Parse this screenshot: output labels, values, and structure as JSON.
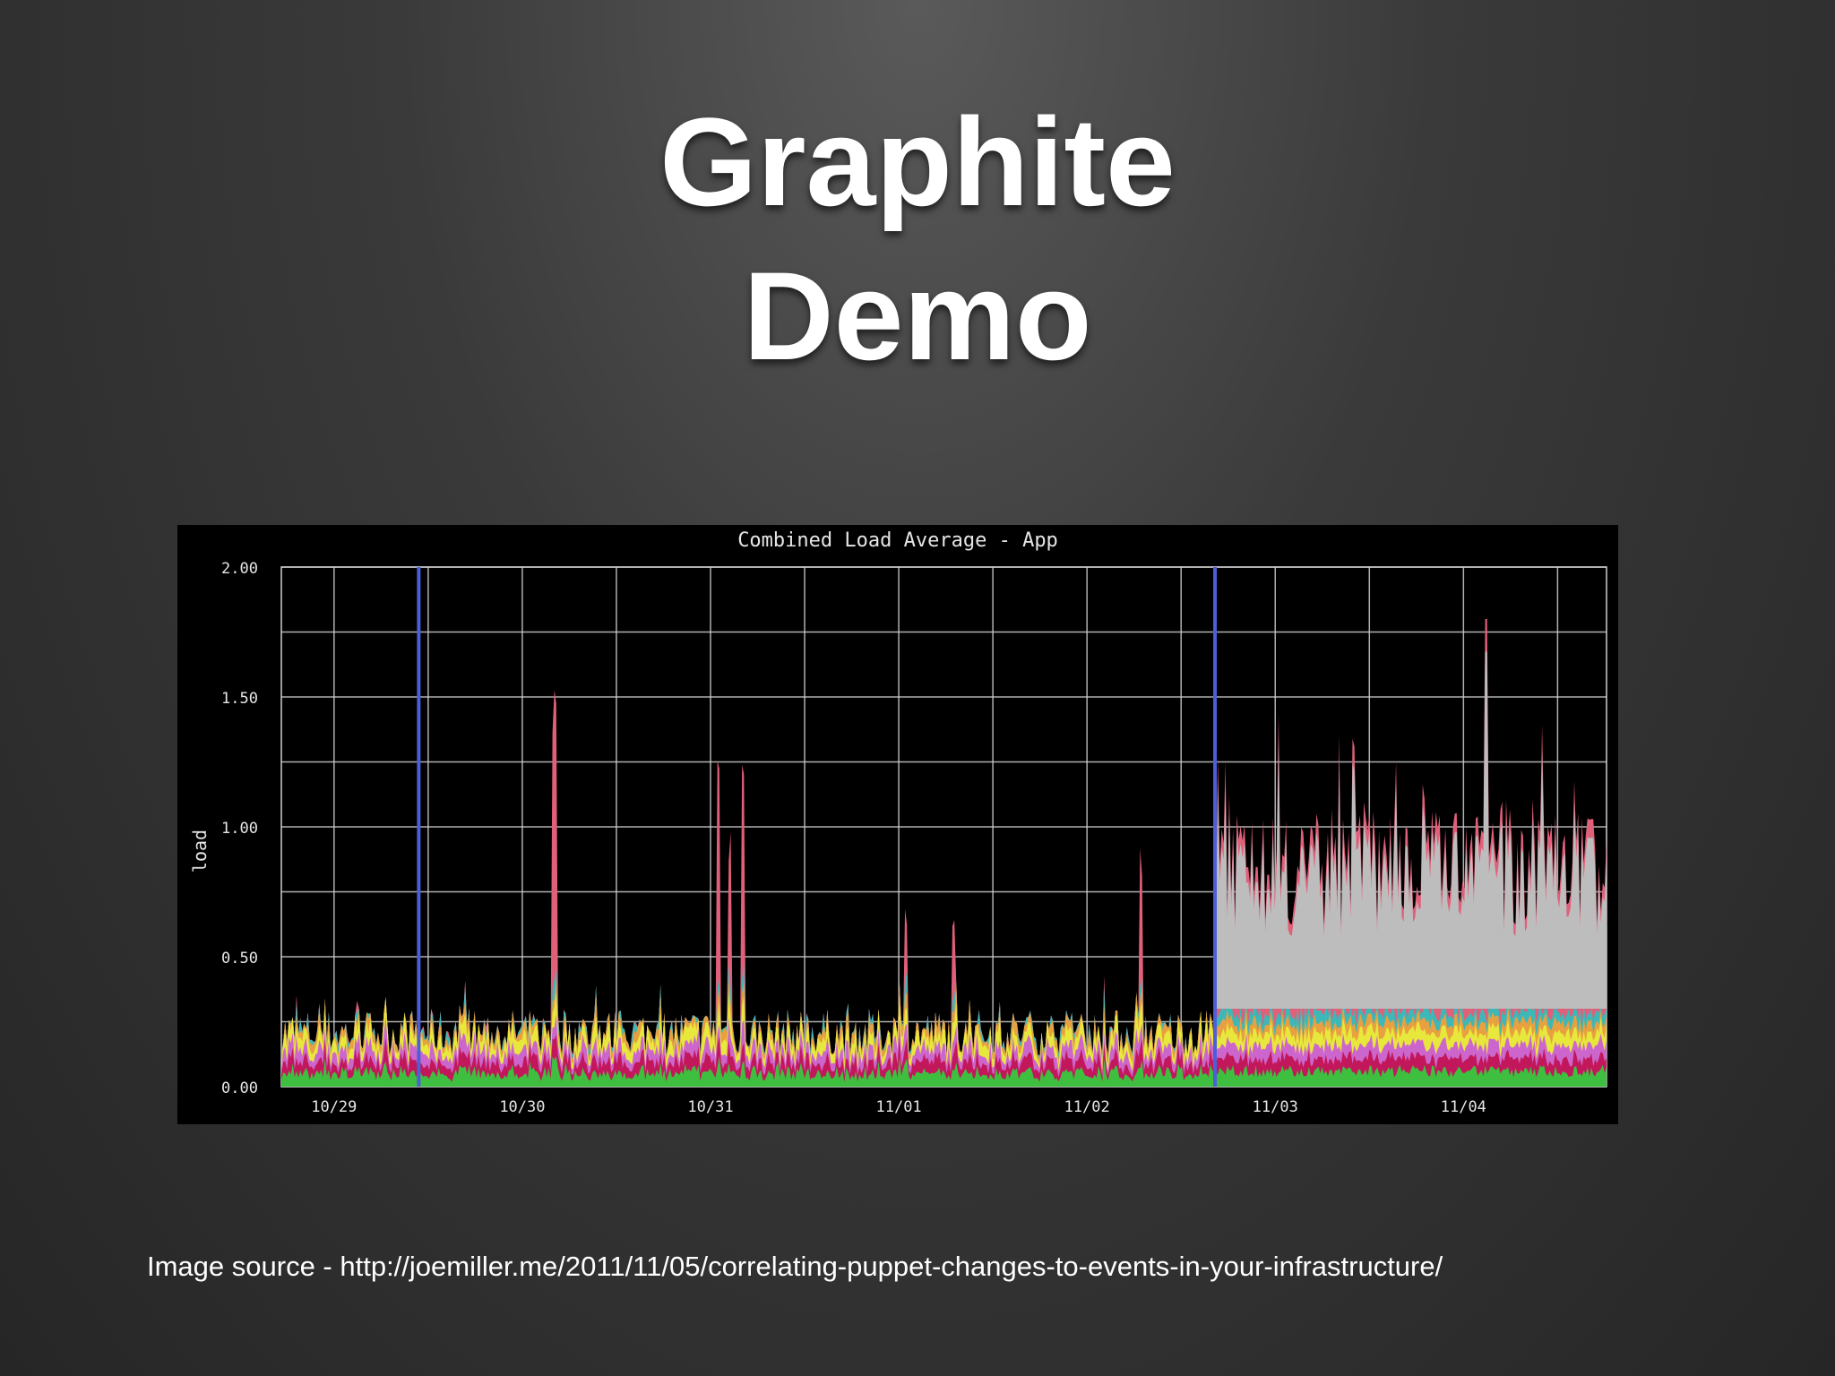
{
  "slide": {
    "title_line1": "Graphite",
    "title_line2": "Demo",
    "caption": "Image source - http://joemiller.me/2011/11/05/correlating-puppet-changes-to-events-in-your-infrastructure/"
  },
  "chart_data": {
    "type": "area",
    "title": "Combined Load Average - App",
    "ylabel": "load",
    "xlabel": "",
    "ylim": [
      0,
      2.0
    ],
    "yticks": [
      "0.00",
      "0.50",
      "1.00",
      "1.50",
      "2.00"
    ],
    "xticks": [
      "10/29",
      "10/30",
      "10/31",
      "11/01",
      "11/02",
      "11/03",
      "11/04"
    ],
    "grid": true,
    "stacked": true,
    "background": "#000000",
    "grid_color": "#cfcfcf",
    "event_marker_color": "#4a5fd8",
    "event_markers": [
      "10/29 ~11:00",
      "11/02 ~16:00"
    ],
    "series_colors": [
      "#3fbf3f",
      "#c2185b",
      "#cc66cc",
      "#e8e83c",
      "#e8a040",
      "#3cb8b8",
      "#e0607a",
      "#bdbdbd"
    ],
    "summary": {
      "baseline_10/28_to_11/02": [
        0.05,
        0.35
      ],
      "spikes": [
        {
          "x": "10/30 ~04:00",
          "y": 1.55
        },
        {
          "x": "10/31 ~01:00",
          "y": 1.3
        },
        {
          "x": "10/31 ~04:00",
          "y": 1.35
        },
        {
          "x": "11/01 ~01:00",
          "y": 0.72
        },
        {
          "x": "11/01 ~07:00",
          "y": 0.65
        },
        {
          "x": "11/02 ~07:00",
          "y": 0.95
        }
      ],
      "elevated_11/02_16:00_to_11/05": [
        0.6,
        1.3
      ],
      "peak": {
        "x": "11/04 ~07:00",
        "y": 1.8
      }
    }
  }
}
